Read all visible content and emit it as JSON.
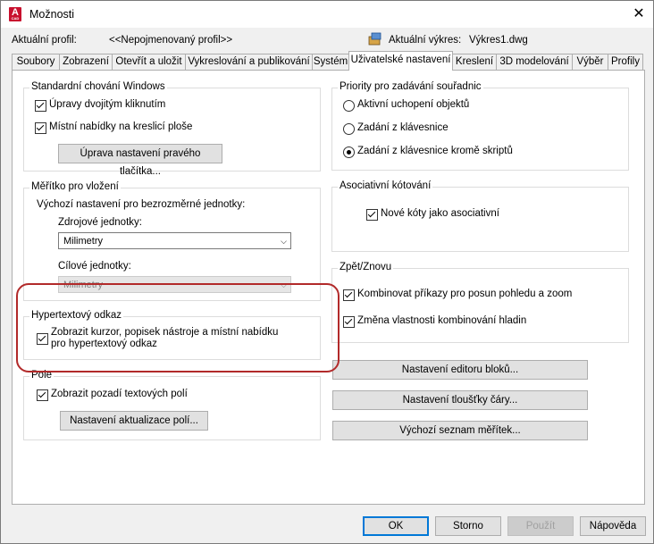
{
  "window": {
    "title": "Možnosti",
    "close": "✕",
    "app_icon_letter": "A",
    "app_icon_small": "CAD"
  },
  "header": {
    "profile_label": "Aktuální profil:",
    "profile_value": "<<Nepojmenovaný profil>>",
    "drawing_label": "Aktuální výkres:",
    "drawing_value": "Výkres1.dwg"
  },
  "tabs": [
    "Soubory",
    "Zobrazení",
    "Otevřít a uložit",
    "Vykreslování a publikování",
    "Systém",
    "Uživatelské nastavení",
    "Kreslení",
    "3D modelování",
    "Výběr",
    "Profily"
  ],
  "active_tab": "Uživatelské nastavení",
  "windows_behavior": {
    "title": "Standardní chování Windows",
    "double_click": {
      "label": "Úpravy dvojitým kliknutím",
      "checked": true
    },
    "shortcut_menus": {
      "label": "Místní nabídky na kreslicí ploše",
      "checked": true
    },
    "right_click_button": "Úprava nastavení pravého tlačítka..."
  },
  "insertion_scale": {
    "title": "Měřítko pro vložení",
    "description": "Výchozí nastavení pro bezrozměrné jednotky:",
    "source_label": "Zdrojové jednotky:",
    "source_value": "Milimetry",
    "target_label": "Cílové jednotky:",
    "target_value": "Milimetry"
  },
  "hyperlink": {
    "title": "Hypertextový odkaz",
    "line1": "Zobrazit kurzor, popisek nástroje a místní nabídku",
    "line2": "pro hypertextový odkaz",
    "checked": true
  },
  "fields": {
    "title": "Pole",
    "background": {
      "label": "Zobrazit pozadí textových polí",
      "checked": true
    },
    "update_button": "Nastavení aktualizace polí..."
  },
  "coordinate_priority": {
    "title": "Priority pro zadávání souřadnic",
    "options": [
      "Aktivní uchopení objektů",
      "Zadání z klávesnice",
      "Zadání z klávesnice kromě skriptů"
    ],
    "selected": "Zadání z klávesnice kromě skriptů"
  },
  "assoc_dim": {
    "title": "Asociativní kótování",
    "new_dims": {
      "label": "Nové kóty jako asociativní",
      "checked": true
    }
  },
  "undo_redo": {
    "title": "Zpět/Znovu",
    "combine_zoom": {
      "label": "Kombinovat příkazy pro posun pohledu a zoom",
      "checked": true
    },
    "combine_layer": {
      "label": "Změna vlastnosti kombinování hladin",
      "checked": true
    }
  },
  "right_buttons": {
    "block_editor": "Nastavení editoru bloků...",
    "lineweight": "Nastavení tloušťky čáry...",
    "scale_list": "Výchozí seznam měřítek..."
  },
  "footer": {
    "ok": "OK",
    "cancel": "Storno",
    "apply": "Použít",
    "help": "Nápověda"
  }
}
